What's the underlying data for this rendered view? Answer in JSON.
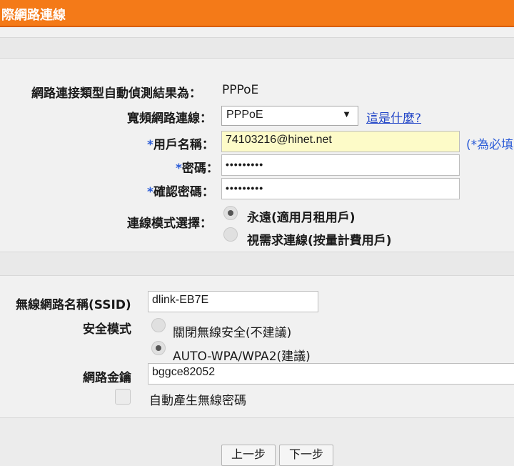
{
  "header": {
    "title": "際網路連線"
  },
  "connection": {
    "detect_label": "網路連接類型自動偵測結果為：",
    "detect_value": "PPPoE",
    "broadband_label": "寬頻網路連線：",
    "broadband_selected": "PPPoE",
    "broadband_arrow": "▼",
    "whats_this_link": "這是什麼?",
    "required_star": "*",
    "username_label": "用戶名稱：",
    "username_value": "74103216@hinet.net",
    "required_note": "(*為必填",
    "password_label": "密碼：",
    "password_value": "•••••••••",
    "confirm_label": "確認密碼：",
    "confirm_value": "•••••••••",
    "mode_label": "連線模式選擇：",
    "mode_options": [
      {
        "label": "永遠(適用月租用戶)",
        "selected": true
      },
      {
        "label": "視需求連線(按量計費用戶)",
        "selected": false
      }
    ]
  },
  "wireless": {
    "ssid_label": "無線網路名稱(SSID)",
    "ssid_value": "dlink-EB7E",
    "security_label": "安全模式",
    "security_options": [
      {
        "label": "關閉無線安全(不建議)",
        "selected": false
      },
      {
        "label": "AUTO-WPA/WPA2(建議)",
        "selected": true
      }
    ],
    "key_label": "網路金鑰",
    "key_value": "bggce82052",
    "auto_generate_label": "自動產生無線密碼",
    "auto_generate_checked": false
  },
  "buttons": {
    "prev": "上一步",
    "next": "下一步"
  },
  "colors": {
    "header_bg": "#f47a18",
    "link": "#2447c8",
    "required": "#2a5bd7",
    "highlight_input": "#fdfbc8"
  }
}
